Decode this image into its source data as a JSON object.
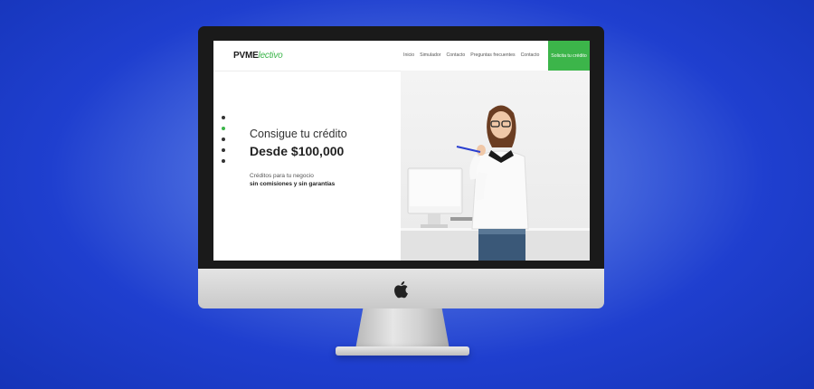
{
  "site": {
    "logo": {
      "part1": "PVME",
      "part2": "lectivo"
    },
    "nav": [
      "Inicio",
      "Simulador",
      "Contacto",
      "Preguntas frecuentes",
      "Contacto"
    ],
    "cta": "Solicita tu crédito"
  },
  "hero": {
    "headline": "Consigue tu crédito",
    "amount": "Desde $100,000",
    "subtitle": "Créditos para tu negocio",
    "subtitle_bold": "sin comisiones y sin garantías"
  },
  "colors": {
    "accent": "#3cb54a",
    "background": "#1f3fcf"
  }
}
